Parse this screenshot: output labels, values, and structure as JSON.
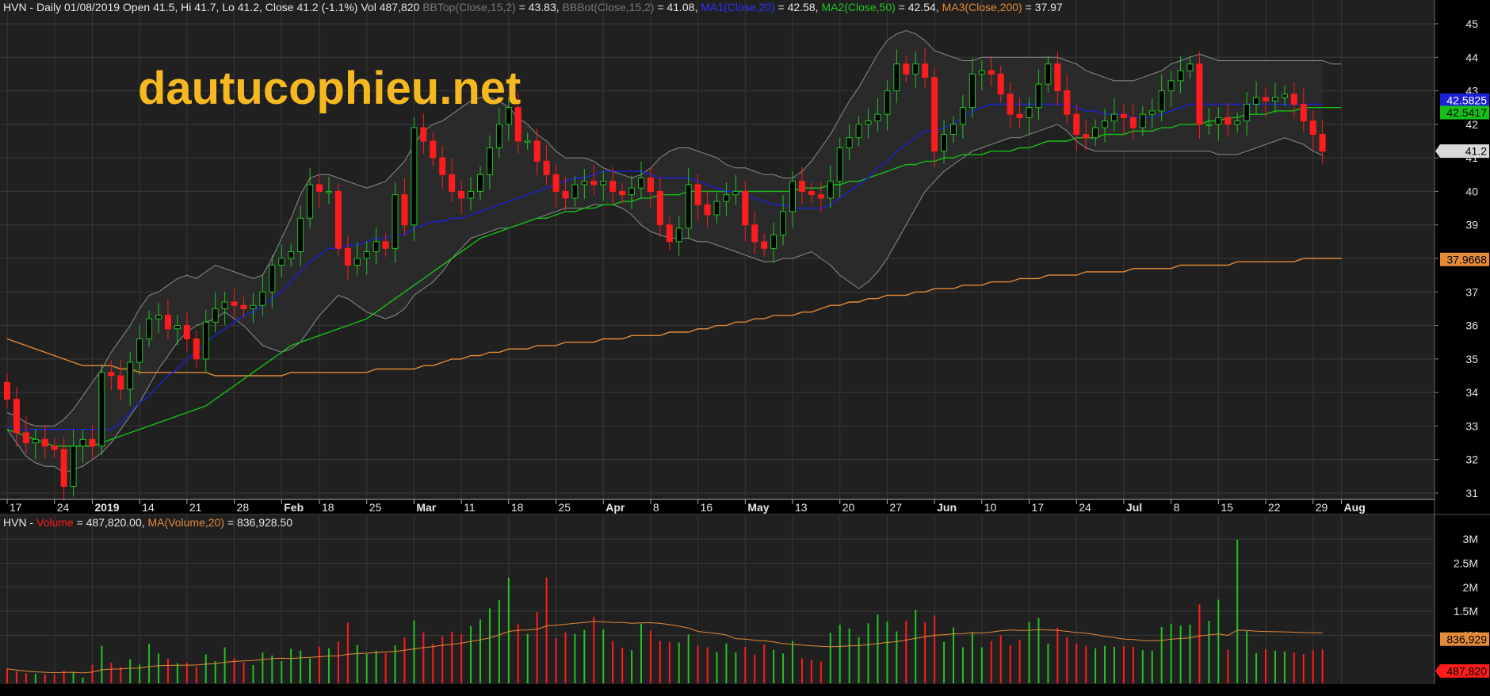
{
  "header": {
    "symbol": "HVN",
    "price_info": "HVN - Daily 01/08/2019 Open 41.5, Hi 41.7, Lo 41.2, Close 41.2 (-1.1%) Vol 487,820",
    "bbtop_label": "BBTop(Close,15,2)",
    "bbtop_value": " = 43.83,",
    "bbbot_label": "BBBot(Close,15,2)",
    "bbbot_value": " = 41.08,",
    "ma1_label": "MA1(Close,20)",
    "ma1_value": " = 42.58,",
    "ma2_label": "MA2(Close,50)",
    "ma2_value": " = 42.54,",
    "ma3_label": "MA3(Close,200)",
    "ma3_value": " = 37.97"
  },
  "volume_header": {
    "prefix": "HVN - ",
    "vol_label": "Volume",
    "vol_value": " = 487,820.00,",
    "ma_label": "MA(Volume,20)",
    "ma_value": " = 836,928.50"
  },
  "watermark": "dautucophieu.net",
  "badges": {
    "ma1": "42.5825",
    "ma2": "42.5417",
    "close": "41.2",
    "ma3": "37.9668",
    "vol_ma": "836,929",
    "vol": "487,820"
  },
  "colors": {
    "up": "#22c322",
    "down": "#ff1c1c",
    "ma1": "#1a22d8",
    "ma2": "#16c016",
    "ma3": "#e58a38",
    "bollinger": "#8c8c8c",
    "watermark": "#f5b820"
  },
  "chart_data": {
    "type": "candlestick",
    "price_axis": {
      "range": [
        30.8,
        45.5
      ],
      "ticks": [
        "31",
        "32",
        "33",
        "34",
        "35",
        "36",
        "37",
        "38",
        "39",
        "40",
        "41",
        "42",
        "43",
        "44",
        "45"
      ]
    },
    "volume_axis": {
      "range": [
        0,
        3200000
      ],
      "ticks": [
        "1M",
        "1.5M",
        "2M",
        "2.5M",
        "3M"
      ]
    },
    "date_labels": [
      {
        "text": "17",
        "day": 0,
        "bold": false
      },
      {
        "text": "24",
        "day": 5,
        "bold": false
      },
      {
        "text": "2019",
        "day": 9,
        "bold": true
      },
      {
        "text": "14",
        "day": 14,
        "bold": false
      },
      {
        "text": "21",
        "day": 19,
        "bold": false
      },
      {
        "text": "28",
        "day": 24,
        "bold": false
      },
      {
        "text": "Feb",
        "day": 29,
        "bold": true
      },
      {
        "text": "18",
        "day": 33,
        "bold": false
      },
      {
        "text": "25",
        "day": 38,
        "bold": false
      },
      {
        "text": "Mar",
        "day": 43,
        "bold": true
      },
      {
        "text": "11",
        "day": 48,
        "bold": false
      },
      {
        "text": "18",
        "day": 53,
        "bold": false
      },
      {
        "text": "25",
        "day": 58,
        "bold": false
      },
      {
        "text": "Apr",
        "day": 63,
        "bold": true
      },
      {
        "text": "8",
        "day": 68,
        "bold": false
      },
      {
        "text": "16",
        "day": 73,
        "bold": false
      },
      {
        "text": "May",
        "day": 78,
        "bold": true
      },
      {
        "text": "13",
        "day": 83,
        "bold": false
      },
      {
        "text": "20",
        "day": 88,
        "bold": false
      },
      {
        "text": "27",
        "day": 93,
        "bold": false
      },
      {
        "text": "Jun",
        "day": 98,
        "bold": true
      },
      {
        "text": "10",
        "day": 103,
        "bold": false
      },
      {
        "text": "17",
        "day": 108,
        "bold": false
      },
      {
        "text": "24",
        "day": 113,
        "bold": false
      },
      {
        "text": "Jul",
        "day": 118,
        "bold": true
      },
      {
        "text": "8",
        "day": 123,
        "bold": false
      },
      {
        "text": "15",
        "day": 128,
        "bold": false
      },
      {
        "text": "22",
        "day": 133,
        "bold": false
      },
      {
        "text": "29",
        "day": 138,
        "bold": false
      },
      {
        "text": "Aug",
        "day": 141,
        "bold": true
      }
    ],
    "closes": [
      33.8,
      32.8,
      32.5,
      32.6,
      32.4,
      32.3,
      31.2,
      32.4,
      32.6,
      32.4,
      34.6,
      34.5,
      34.1,
      34.9,
      35.6,
      36.2,
      36.3,
      35.9,
      36.0,
      35.6,
      35.0,
      36.1,
      36.5,
      36.7,
      36.6,
      36.5,
      36.6,
      37.0,
      37.8,
      38.0,
      38.2,
      39.2,
      40.2,
      40.0,
      40.0,
      38.3,
      37.8,
      38.0,
      38.2,
      38.5,
      38.3,
      39.9,
      39.0,
      41.9,
      41.5,
      41.0,
      40.5,
      40.0,
      39.8,
      40.0,
      40.5,
      41.3,
      42.0,
      42.5,
      41.5,
      41.5,
      40.9,
      40.5,
      40.0,
      39.8,
      40.2,
      40.3,
      40.2,
      40.3,
      40.0,
      39.9,
      40.1,
      40.4,
      40.0,
      39.0,
      38.5,
      38.9,
      40.2,
      39.6,
      39.3,
      39.7,
      39.9,
      40.0,
      39.0,
      38.5,
      38.3,
      38.7,
      39.4,
      40.3,
      40.0,
      39.9,
      39.8,
      40.3,
      41.3,
      41.6,
      42.0,
      42.1,
      42.3,
      43.0,
      43.8,
      43.5,
      43.8,
      43.4,
      41.2,
      41.7,
      42.0,
      42.5,
      43.5,
      43.6,
      43.5,
      42.9,
      42.3,
      42.2,
      42.5,
      43.2,
      43.8,
      43.0,
      42.3,
      41.7,
      41.6,
      41.9,
      42.1,
      42.3,
      42.2,
      41.9,
      42.3,
      42.4,
      43.0,
      43.3,
      43.6,
      43.8,
      42.0,
      42.0,
      42.2,
      42.0,
      42.1,
      42.6,
      42.8,
      42.7,
      42.8,
      42.9,
      42.6,
      42.1,
      41.7,
      41.2
    ],
    "volumes": [
      300000,
      250000,
      210000,
      200000,
      190000,
      180000,
      260000,
      240000,
      120000,
      380000,
      780000,
      430000,
      340000,
      500000,
      390000,
      820000,
      620000,
      510000,
      420000,
      430000,
      350000,
      600000,
      460000,
      750000,
      520000,
      430000,
      380000,
      640000,
      580000,
      460000,
      720000,
      680000,
      520000,
      760000,
      730000,
      870000,
      1260000,
      800000,
      610000,
      680000,
      630000,
      790000,
      950000,
      1310000,
      1060000,
      820000,
      980000,
      1070000,
      1020000,
      1190000,
      1330000,
      1560000,
      1730000,
      2200000,
      1230000,
      1030000,
      1480000,
      2200000,
      940000,
      1060000,
      1030000,
      1110000,
      1390000,
      1120000,
      880000,
      740000,
      690000,
      1240000,
      1090000,
      880000,
      860000,
      850000,
      1020000,
      780000,
      750000,
      650000,
      830000,
      640000,
      760000,
      590000,
      810000,
      700000,
      620000,
      880000,
      520000,
      490000,
      450000,
      1050000,
      1220000,
      1140000,
      960000,
      1250000,
      1430000,
      1280000,
      1080000,
      1300000,
      1530000,
      1270000,
      1410000,
      860000,
      1160000,
      750000,
      1060000,
      750000,
      880000,
      1000000,
      790000,
      910000,
      1270000,
      1360000,
      830000,
      1160000,
      960000,
      830000,
      780000,
      730000,
      780000,
      760000,
      770000,
      760000,
      690000,
      680000,
      1170000,
      1240000,
      1200000,
      1220000,
      1640000,
      1300000,
      1740000,
      700000,
      2990000,
      1090000,
      630000,
      710000,
      680000,
      660000,
      640000,
      610000,
      690000,
      700000,
      590000,
      560000,
      500000,
      490000
    ],
    "ma1": [
      33.0,
      32.9,
      32.9,
      32.9,
      32.9,
      32.9,
      32.9,
      32.9,
      32.9,
      32.9,
      32.9,
      32.9,
      33.1,
      33.4,
      33.7,
      33.9,
      34.2,
      34.5,
      34.7,
      35.0,
      35.2,
      35.5,
      35.7,
      35.9,
      36.1,
      36.3,
      36.4,
      36.6,
      36.8,
      37.0,
      37.3,
      37.6,
      37.9,
      38.1,
      38.3,
      38.3,
      38.4,
      38.4,
      38.5,
      38.6,
      38.6,
      38.7,
      38.7,
      38.9,
      39.0,
      39.1,
      39.1,
      39.2,
      39.2,
      39.3,
      39.4,
      39.5,
      39.6,
      39.7,
      39.8,
      39.9,
      40.0,
      40.1,
      40.2,
      40.3,
      40.4,
      40.4,
      40.5,
      40.6,
      40.6,
      40.6,
      40.6,
      40.6,
      40.5,
      40.4,
      40.4,
      40.4,
      40.4,
      40.3,
      40.2,
      40.1,
      40.0,
      40.0,
      39.9,
      39.8,
      39.7,
      39.6,
      39.6,
      39.5,
      39.5,
      39.5,
      39.5,
      39.6,
      39.8,
      40.0,
      40.2,
      40.4,
      40.7,
      40.9,
      41.2,
      41.4,
      41.6,
      41.8,
      41.8,
      41.9,
      42.0,
      42.2,
      42.4,
      42.5,
      42.6,
      42.6,
      42.6,
      42.6,
      42.6,
      42.6,
      42.6,
      42.6,
      42.6,
      42.5,
      42.4,
      42.4,
      42.3,
      42.3,
      42.3,
      42.2,
      42.2,
      42.2,
      42.3,
      42.4,
      42.5,
      42.6,
      42.6,
      42.6,
      42.6,
      42.6,
      42.6,
      42.6,
      42.6,
      42.6,
      42.6,
      42.6,
      42.6,
      42.6,
      42.6,
      42.6
    ],
    "ma2": [
      32.9,
      32.8,
      32.7,
      32.6,
      32.5,
      32.4,
      32.4,
      32.4,
      32.4,
      32.4,
      32.5,
      32.6,
      32.7,
      32.8,
      32.9,
      33.0,
      33.1,
      33.2,
      33.3,
      33.4,
      33.5,
      33.6,
      33.8,
      34.0,
      34.2,
      34.4,
      34.6,
      34.8,
      35.0,
      35.2,
      35.4,
      35.5,
      35.6,
      35.7,
      35.8,
      35.9,
      36.0,
      36.1,
      36.2,
      36.4,
      36.6,
      36.8,
      37.0,
      37.2,
      37.4,
      37.6,
      37.8,
      38.0,
      38.2,
      38.4,
      38.6,
      38.7,
      38.8,
      38.9,
      39.0,
      39.1,
      39.2,
      39.2,
      39.3,
      39.4,
      39.4,
      39.5,
      39.5,
      39.6,
      39.6,
      39.7,
      39.7,
      39.8,
      39.8,
      39.9,
      39.9,
      39.9,
      40.0,
      40.0,
      40.0,
      40.0,
      40.0,
      40.0,
      40.0,
      40.0,
      40.0,
      40.0,
      40.0,
      40.0,
      40.1,
      40.1,
      40.1,
      40.2,
      40.2,
      40.3,
      40.3,
      40.4,
      40.5,
      40.6,
      40.7,
      40.8,
      40.8,
      40.9,
      40.9,
      41.0,
      41.0,
      41.1,
      41.1,
      41.1,
      41.2,
      41.2,
      41.2,
      41.3,
      41.3,
      41.4,
      41.5,
      41.5,
      41.5,
      41.6,
      41.6,
      41.6,
      41.7,
      41.7,
      41.7,
      41.8,
      41.8,
      41.8,
      41.9,
      41.9,
      42.0,
      42.0,
      42.0,
      42.1,
      42.1,
      42.2,
      42.2,
      42.3,
      42.3,
      42.3,
      42.4,
      42.4,
      42.4,
      42.5,
      42.5,
      42.5,
      42.5,
      42.5
    ],
    "ma3": [
      35.6,
      35.5,
      35.4,
      35.3,
      35.2,
      35.1,
      35.0,
      34.9,
      34.8,
      34.8,
      34.8,
      34.8,
      34.7,
      34.7,
      34.6,
      34.6,
      34.6,
      34.6,
      34.6,
      34.6,
      34.6,
      34.6,
      34.5,
      34.5,
      34.5,
      34.5,
      34.5,
      34.5,
      34.5,
      34.5,
      34.6,
      34.6,
      34.6,
      34.6,
      34.6,
      34.6,
      34.6,
      34.6,
      34.6,
      34.7,
      34.7,
      34.7,
      34.7,
      34.7,
      34.8,
      34.8,
      34.9,
      35.0,
      35.0,
      35.1,
      35.1,
      35.2,
      35.2,
      35.3,
      35.3,
      35.3,
      35.4,
      35.4,
      35.4,
      35.5,
      35.5,
      35.5,
      35.5,
      35.6,
      35.6,
      35.6,
      35.7,
      35.7,
      35.7,
      35.7,
      35.8,
      35.8,
      35.8,
      35.9,
      35.9,
      36.0,
      36.0,
      36.1,
      36.1,
      36.2,
      36.2,
      36.3,
      36.3,
      36.3,
      36.4,
      36.4,
      36.5,
      36.6,
      36.6,
      36.7,
      36.7,
      36.8,
      36.8,
      36.9,
      36.9,
      36.9,
      37.0,
      37.0,
      37.1,
      37.1,
      37.1,
      37.2,
      37.2,
      37.2,
      37.3,
      37.3,
      37.3,
      37.4,
      37.4,
      37.4,
      37.5,
      37.5,
      37.5,
      37.5,
      37.6,
      37.6,
      37.6,
      37.6,
      37.6,
      37.7,
      37.7,
      37.7,
      37.7,
      37.7,
      37.8,
      37.8,
      37.8,
      37.8,
      37.8,
      37.8,
      37.9,
      37.9,
      37.9,
      37.9,
      37.9,
      37.9,
      37.9,
      38.0,
      38.0,
      38.0,
      38.0,
      38.0
    ],
    "bb_top": [
      33.4,
      33.3,
      33.1,
      33.0,
      33.0,
      33.0,
      33.2,
      33.5,
      33.9,
      34.3,
      34.7,
      35.2,
      35.6,
      36.0,
      36.5,
      36.9,
      37.0,
      37.2,
      37.4,
      37.5,
      37.4,
      37.6,
      37.8,
      37.7,
      37.6,
      37.5,
      37.4,
      37.5,
      38.0,
      38.6,
      39.2,
      39.9,
      40.4,
      40.5,
      40.5,
      40.4,
      40.3,
      40.2,
      40.1,
      40.2,
      40.3,
      40.6,
      40.9,
      41.4,
      41.8,
      42.0,
      42.1,
      42.3,
      42.5,
      42.7,
      42.8,
      42.8,
      42.7,
      42.5,
      42.2,
      42.0,
      41.7,
      41.5,
      41.2,
      41.0,
      41.0,
      41.0,
      40.9,
      40.7,
      40.6,
      40.5,
      40.4,
      40.5,
      40.7,
      41.0,
      41.2,
      41.3,
      41.3,
      41.2,
      41.1,
      41.0,
      40.8,
      40.7,
      40.7,
      40.6,
      40.5,
      40.5,
      40.4,
      40.4,
      40.6,
      40.9,
      41.3,
      41.7,
      42.2,
      42.7,
      43.1,
      43.6,
      44.1,
      44.5,
      44.7,
      44.8,
      44.7,
      44.5,
      44.2,
      44.1,
      44.0,
      43.9,
      43.9,
      44.0,
      44.0,
      44.0,
      44.0,
      44.0,
      44.0,
      44.0,
      44.0,
      44.0,
      43.9,
      43.8,
      43.6,
      43.5,
      43.4,
      43.3,
      43.3,
      43.3,
      43.4,
      43.5,
      43.6,
      43.8,
      43.9,
      44.0,
      44.1,
      44.0,
      43.9,
      43.9,
      43.9,
      43.9,
      43.9,
      43.9,
      43.9,
      43.9,
      43.9,
      43.9,
      43.9,
      43.9,
      43.8,
      43.8
    ],
    "bb_bot": [
      32.9,
      32.5,
      32.1,
      31.9,
      31.8,
      31.8,
      31.6,
      31.7,
      31.8,
      32.0,
      32.2,
      32.5,
      32.9,
      33.3,
      33.7,
      34.2,
      34.7,
      35.1,
      35.5,
      35.8,
      36.0,
      36.1,
      36.2,
      36.4,
      36.2,
      36.0,
      35.7,
      35.4,
      35.3,
      35.2,
      35.3,
      35.5,
      35.9,
      36.3,
      36.6,
      36.9,
      36.8,
      36.6,
      36.4,
      36.3,
      36.2,
      36.3,
      36.5,
      36.9,
      37.1,
      37.3,
      37.6,
      38.0,
      38.3,
      38.6,
      38.7,
      38.8,
      38.9,
      38.9,
      39.0,
      39.1,
      39.2,
      39.3,
      39.4,
      39.5,
      39.5,
      39.5,
      39.6,
      39.6,
      39.6,
      39.5,
      39.3,
      39.0,
      38.8,
      38.7,
      38.6,
      38.6,
      38.6,
      38.5,
      38.5,
      38.4,
      38.3,
      38.2,
      38.1,
      38.0,
      37.9,
      37.9,
      38.0,
      38.0,
      38.1,
      38.2,
      38.0,
      37.8,
      37.5,
      37.3,
      37.1,
      37.3,
      37.6,
      38.0,
      38.5,
      39.0,
      39.5,
      40.0,
      40.3,
      40.6,
      40.8,
      41.0,
      41.2,
      41.3,
      41.4,
      41.5,
      41.6,
      41.6,
      41.7,
      41.8,
      41.9,
      42.0,
      41.8,
      41.5,
      41.3,
      41.2,
      41.2,
      41.2,
      41.2,
      41.2,
      41.2,
      41.2,
      41.2,
      41.2,
      41.2,
      41.2,
      41.2,
      41.2,
      41.1,
      41.1,
      41.1,
      41.2,
      41.3,
      41.4,
      41.5,
      41.6,
      41.5,
      41.4,
      41.2,
      41.08
    ]
  }
}
